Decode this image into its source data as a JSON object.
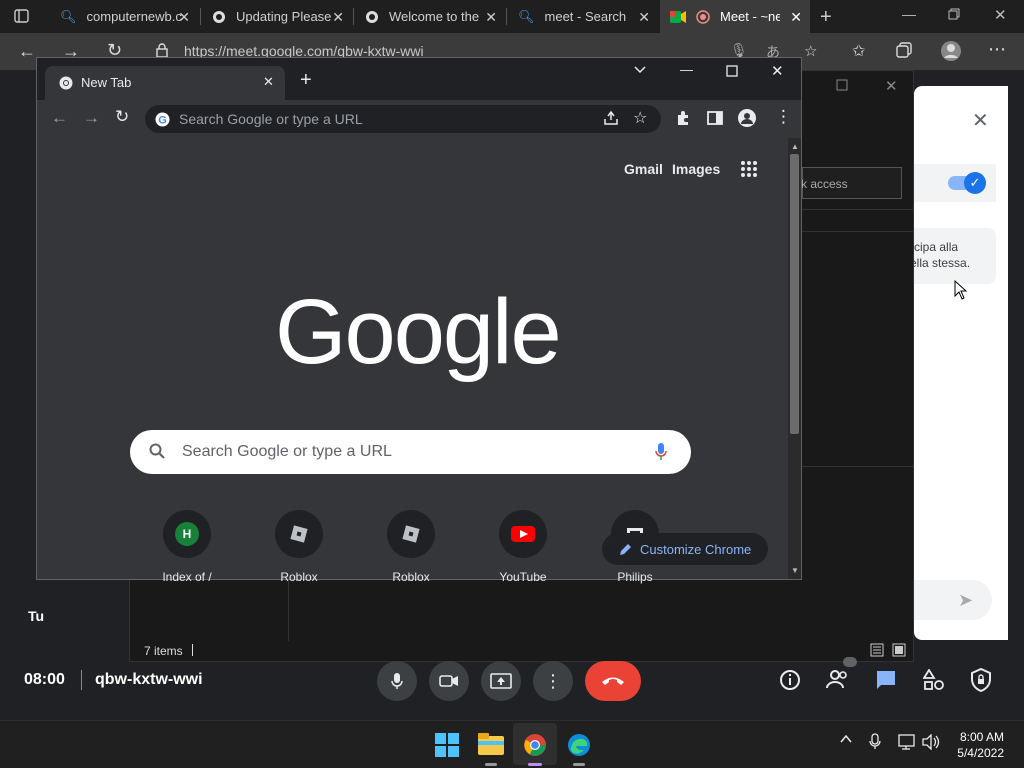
{
  "edge": {
    "tabs": [
      {
        "label": "computernewb.c"
      },
      {
        "label": "Updating Please"
      },
      {
        "label": "Welcome to the"
      },
      {
        "label": "meet - Search"
      },
      {
        "label": "Meet - ~ne"
      }
    ],
    "url": "https://meet.google.com/qbw-kxtw-wwi"
  },
  "meet": {
    "access_field": "ck access",
    "italian_line1": "cipa alla",
    "italian_line2": "ella stessa.",
    "participant": "Tu",
    "time": "08:00",
    "meeting_code": "qbw-kxtw-wwi",
    "items_count": "7 items"
  },
  "chrome": {
    "tab_title": "New Tab",
    "omnibox_placeholder": "Search Google or type a URL",
    "gmail": "Gmail",
    "images": "Images",
    "logo": "Google",
    "search_placeholder": "Search Google or type a URL",
    "shortcuts": [
      {
        "label": "Index of /",
        "letter": "H"
      },
      {
        "label": "Roblox"
      },
      {
        "label": "Roblox"
      },
      {
        "label": "YouTube"
      },
      {
        "label": "Philips"
      }
    ],
    "customize": "Customize Chrome"
  },
  "taskbar": {
    "time": "8:00 AM",
    "date": "5/4/2022"
  },
  "colors": {
    "meet_end_call": "#ea4335",
    "chrome_dark": "#35363a",
    "accent_blue": "#8ab4f8"
  }
}
